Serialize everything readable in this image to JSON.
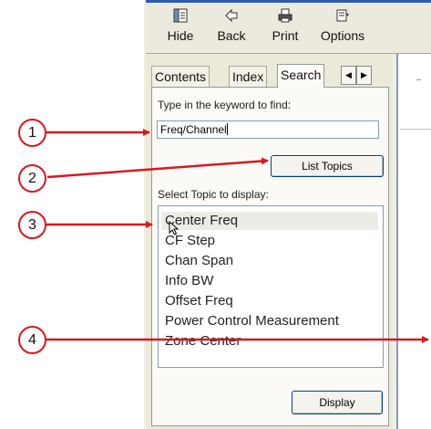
{
  "toolbar": {
    "hide_label": "Hide",
    "back_label": "Back",
    "print_label": "Print",
    "options_label": "Options"
  },
  "tabs": [
    {
      "label": "Contents"
    },
    {
      "label": "Index"
    },
    {
      "label": "Search",
      "active": true
    }
  ],
  "search": {
    "keyword_label": "Type in the keyword to find:",
    "keyword_value": "Freq/Channel",
    "list_topics_label": "List Topics",
    "select_topic_label": "Select Topic to display:",
    "topics": [
      "Center Freq",
      "CF Step",
      "Chan Span",
      "Info BW",
      "Offset Freq",
      "Power Control Measurement",
      "Zone Center"
    ],
    "selected_topic_index": 0,
    "display_label": "Display"
  },
  "callouts": [
    "1",
    "2",
    "3",
    "4"
  ],
  "colors": {
    "callout_red": "#d71920",
    "title_bar_blue": "#2f5aa8",
    "input_border": "#7f9db9"
  }
}
